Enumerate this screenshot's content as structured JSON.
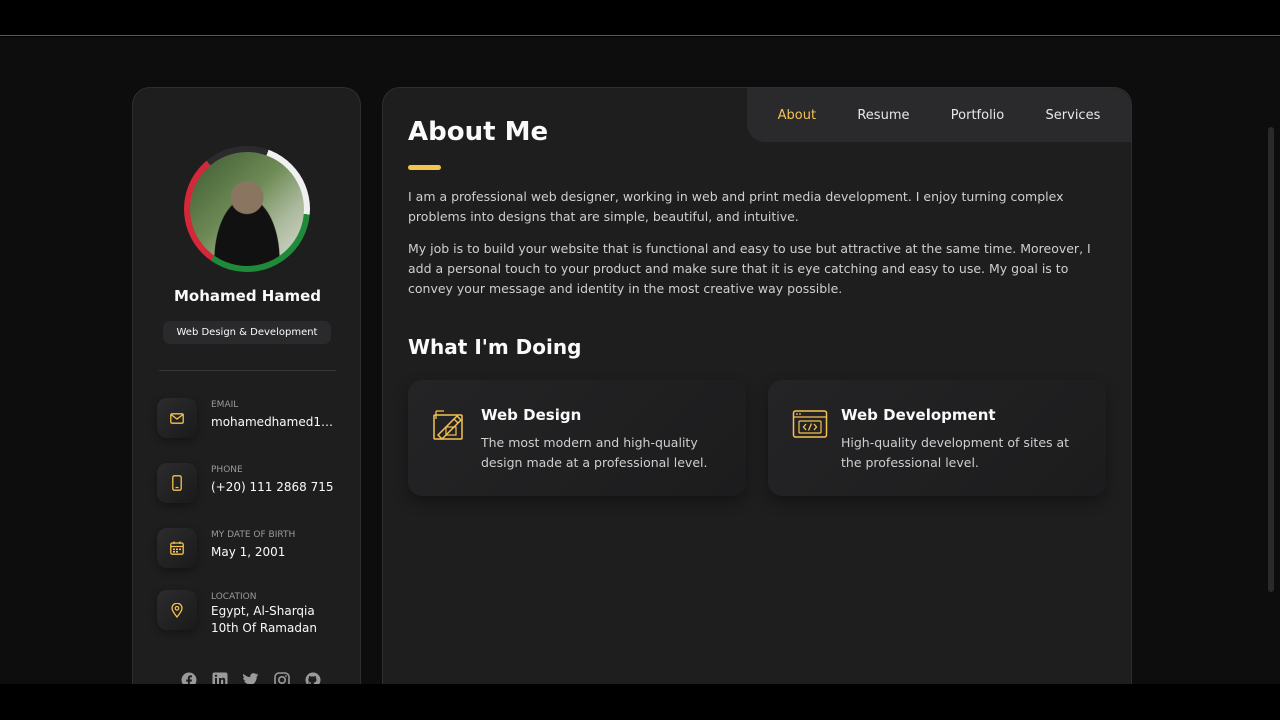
{
  "profile": {
    "name": "Mohamed Hamed",
    "title": "Web Design & Development"
  },
  "contacts": [
    {
      "icon": "mail-icon",
      "label": "Email",
      "value": "mohamedhamed15..."
    },
    {
      "icon": "phone-icon",
      "label": "Phone",
      "value": "(+20) 111 2868 715"
    },
    {
      "icon": "calendar-icon",
      "label": "My Date of Birth",
      "value": "May 1, 2001"
    },
    {
      "icon": "location-icon",
      "label": "Location",
      "value": "Egypt, Al-Sharqia",
      "value2": "10th Of Ramadan"
    }
  ],
  "socials": [
    "facebook-icon",
    "linkedin-icon",
    "twitter-icon",
    "instagram-icon",
    "github-icon"
  ],
  "nav": {
    "items": [
      "About",
      "Resume",
      "Portfolio",
      "Services"
    ],
    "active": "About"
  },
  "about": {
    "heading": "About Me",
    "paragraphs": [
      "I am a professional web designer, working in web and print media development. I enjoy turning complex problems into designs that are simple, beautiful, and intuitive.",
      "My job is to build your website that is functional and easy to use but attractive at the same time. Moreover, I add a personal touch to your product and make sure that it is eye catching and easy to use. My goal is to convey your message and identity in the most creative way possible."
    ]
  },
  "doing": {
    "heading": "What I'm Doing",
    "services": [
      {
        "icon": "design-icon",
        "title": "Web Design",
        "text": "The most modern and high-quality design made at a professional level."
      },
      {
        "icon": "code-icon",
        "title": "Web Development",
        "text": "High-quality development of sites at the professional level."
      }
    ]
  },
  "colors": {
    "accent": "#f4c24f",
    "card": "#1e1e1f",
    "background": "#0d0d0e"
  }
}
